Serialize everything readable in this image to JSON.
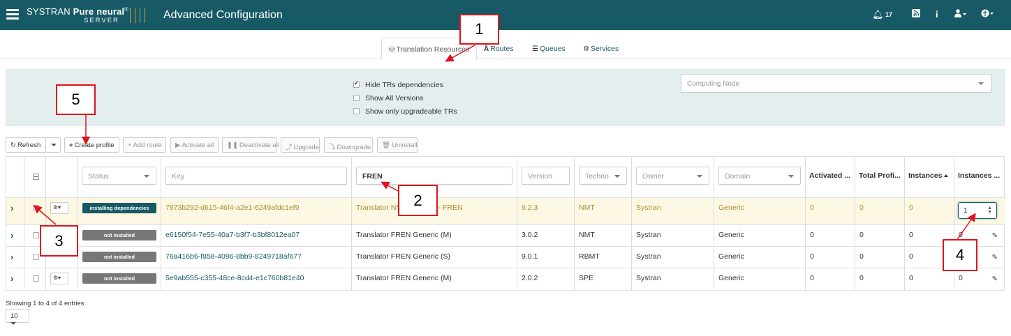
{
  "header": {
    "brand_name": "SYSTRAN",
    "brand_product": "Pure neural",
    "brand_reg": "®",
    "brand_sub": "SERVER",
    "title": "Advanced Configuration",
    "notification_count": "17"
  },
  "tabs": [
    {
      "label": "Translation Resources",
      "icon": "hdd-icon"
    },
    {
      "label": "Routes",
      "icon": "road-icon"
    },
    {
      "label": "Queues",
      "icon": "tasks-icon"
    },
    {
      "label": "Services",
      "icon": "cogs-icon"
    }
  ],
  "filters": {
    "hide_deps": "Hide TRs dependencies",
    "show_all": "Show All Versions",
    "show_upgradeable": "Show only upgradeable TRs",
    "computing_node_placeholder": "Computing Node"
  },
  "toolbar": {
    "refresh": "Refresh",
    "create_profile": "Create profile",
    "add_route": "Add route",
    "activate_all": "Activate all",
    "deactivate_all": "Deactivate all",
    "upgrade": "Upgrade",
    "downgrade": "Downgrade",
    "uninstall": "Uninstall"
  },
  "table": {
    "headers": {
      "status": "Status",
      "key": "Key",
      "name_filter": "FREN",
      "version": "Version",
      "techno": "Techno",
      "owner": "Owner",
      "domain": "Domain",
      "activated": "Activated ...",
      "total_profiles": "Total Profi...",
      "instances": "Instances",
      "instances_target": "Instances ..."
    },
    "rows": [
      {
        "status": "installing dependencies",
        "key": "7873b292-d615-46f4-a2e1-6249afdc1ef9",
        "name": "Translator NM",
        "name_end": ") - FREN",
        "version": "9.2.3",
        "techno": "NMT",
        "owner": "Systran",
        "domain": "Generic",
        "activated": "0",
        "total_profiles": "0",
        "instances": "0",
        "instances_target": "1"
      },
      {
        "status": "not installed",
        "key": "e6150f54-7e55-40a7-b3f7-b3bf8012ea07",
        "name": "Translator FREN Generic (M)",
        "version": "3.0.2",
        "techno": "NMT",
        "owner": "Systran",
        "domain": "Generic",
        "activated": "0",
        "total_profiles": "0",
        "instances": "0",
        "instances_target": "0"
      },
      {
        "status": "not installed",
        "key": "76a416b6-f858-4096-8bb9-8249718af677",
        "name": "Translator FREN Generic (S)",
        "version": "9.0.1",
        "techno": "RBMT",
        "owner": "Systran",
        "domain": "Generic",
        "activated": "0",
        "total_profiles": "0",
        "instances": "0",
        "instances_target": "0"
      },
      {
        "status": "not installed",
        "key": "5e9ab555-c355-48ce-8cd4-e1c760b81e40",
        "name": "Translator FREN Generic (M)",
        "version": "2.0.2",
        "techno": "SPE",
        "owner": "Systran",
        "domain": "Generic",
        "activated": "0",
        "total_profiles": "0",
        "instances": "0",
        "instances_target": "0"
      }
    ]
  },
  "footer": {
    "entries": "Showing 1 to 4 of 4 entries",
    "page_size": "10"
  },
  "annotations": [
    "1",
    "2",
    "3",
    "4",
    "5"
  ],
  "colors": {
    "brand": "#175a66",
    "callout": "#e0121b",
    "highlight_row": "#fcf8e3",
    "accent_gold": "#b08d31"
  }
}
